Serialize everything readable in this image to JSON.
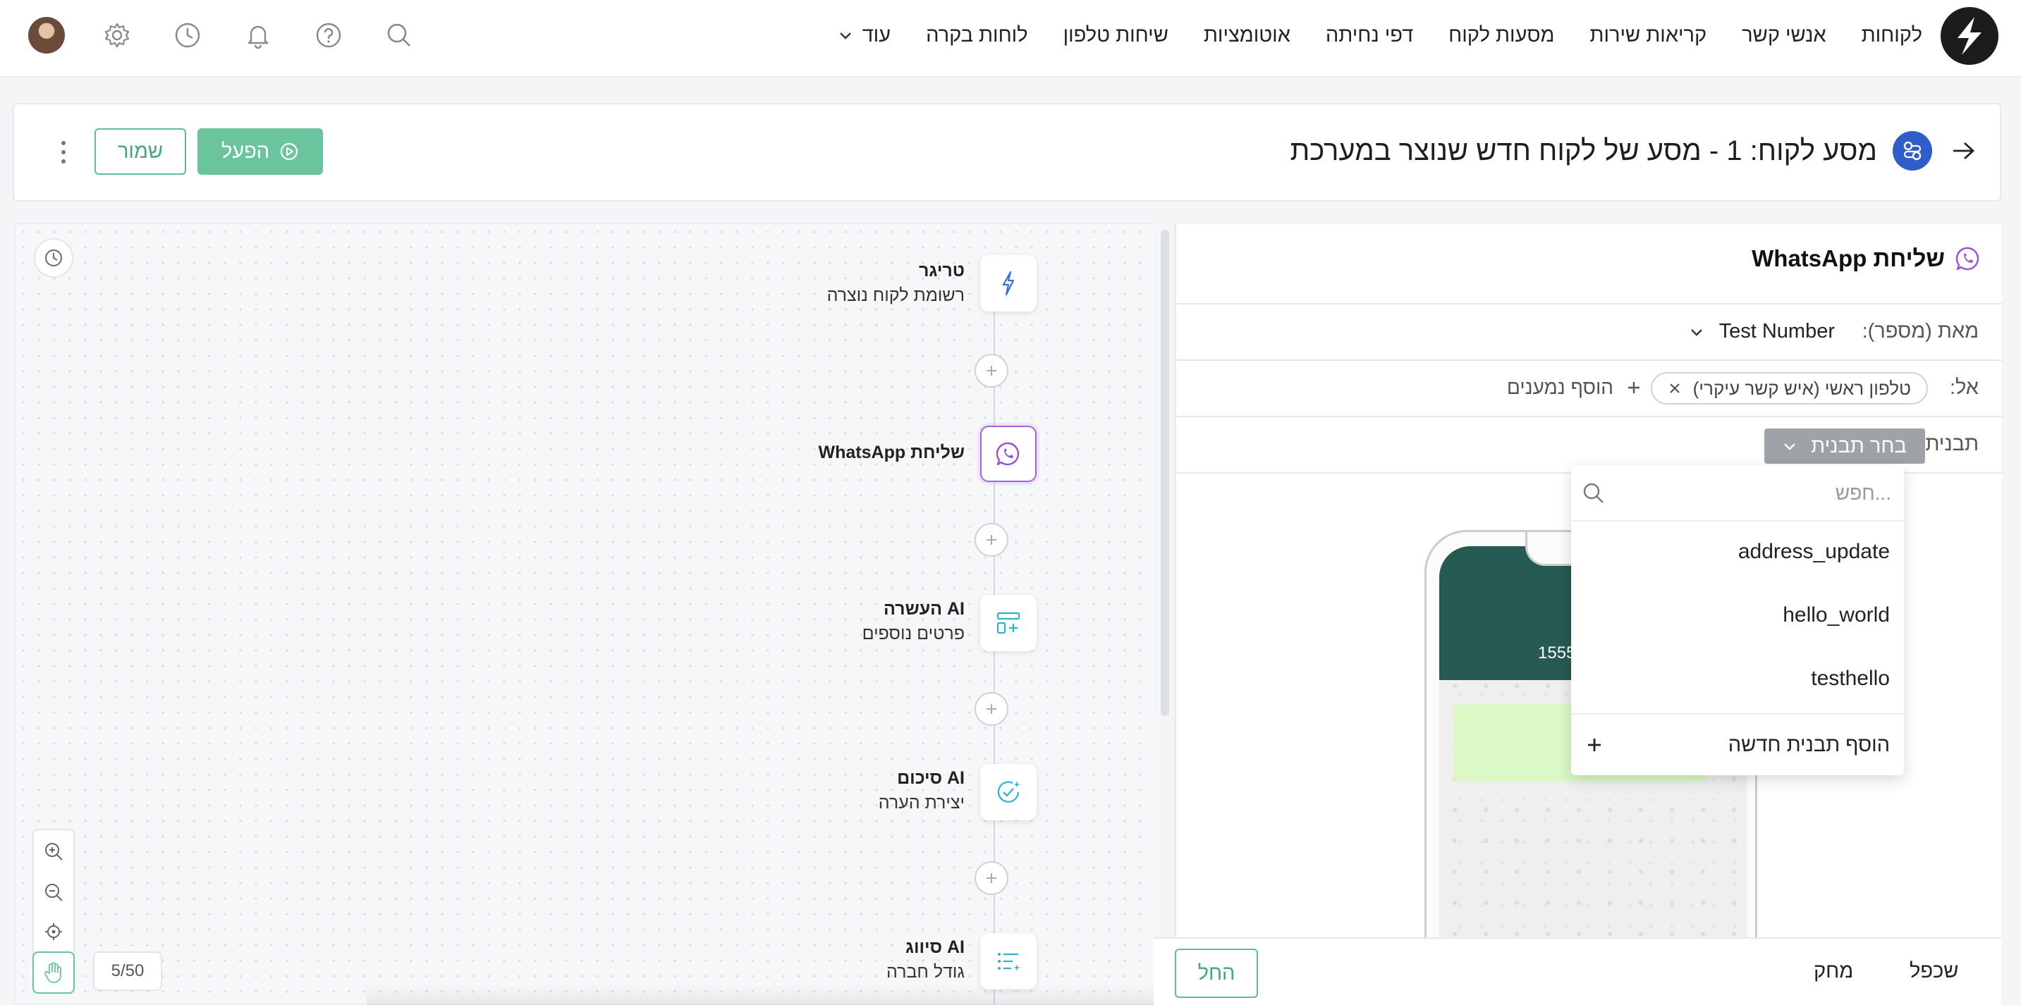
{
  "nav": {
    "items": [
      "לקוחות",
      "אנשי קשר",
      "קריאות שירות",
      "מסעות לקוח",
      "דפי נחיתה",
      "אוטומציות",
      "שיחות טלפון",
      "לוחות בקרה"
    ],
    "more_label": "עוד",
    "icons": [
      "search-icon",
      "help-icon",
      "bell-icon",
      "clock-icon",
      "gear-icon",
      "avatar"
    ]
  },
  "titlebar": {
    "title": "מסע לקוח: 1 - מסע של לקוח חדש שנוצר במערכת",
    "run_label": "הפעל",
    "save_label": "שמור"
  },
  "flow": {
    "nodes": [
      {
        "title": "טריגר",
        "subtitle": "רשומת לקוח נוצרה",
        "icon": "bolt-icon"
      },
      {
        "title": "שליחת WhatsApp",
        "subtitle": "",
        "icon": "whatsapp-icon"
      },
      {
        "title": "AI העשרה",
        "subtitle": "פרטים נוספים",
        "icon": "enrich-icon"
      },
      {
        "title": "AI סיכום",
        "subtitle": "יצירת הערה",
        "icon": "summary-icon"
      },
      {
        "title": "AI סיווג",
        "subtitle": "גודל חברה",
        "icon": "classify-icon"
      }
    ],
    "counter": "5/50"
  },
  "panel": {
    "title": "שליחת WhatsApp",
    "from_label": "מאת (מספר):",
    "from_value": "Test Number",
    "to_label": "אל:",
    "to_chip": "טלפון ראשי (איש קשר עיקרי)",
    "add_recipients": "הוסף נמענים",
    "template_label": "תבנית:",
    "template_select": "בחר תבנית",
    "phone_number": "1555"
  },
  "dropdown": {
    "search_placeholder": "חפש...",
    "options": [
      "address_update",
      "hello_world",
      "testhello"
    ],
    "add_label": "הוסף תבנית חדשה"
  },
  "footer": {
    "apply": "החל",
    "delete": "מחק",
    "duplicate": "שכפל"
  },
  "colors": {
    "accent_green": "#6ac49d",
    "whatsapp_purple": "#a561e0",
    "journey_blue": "#2f5dc9",
    "phone_header": "#265a52"
  }
}
